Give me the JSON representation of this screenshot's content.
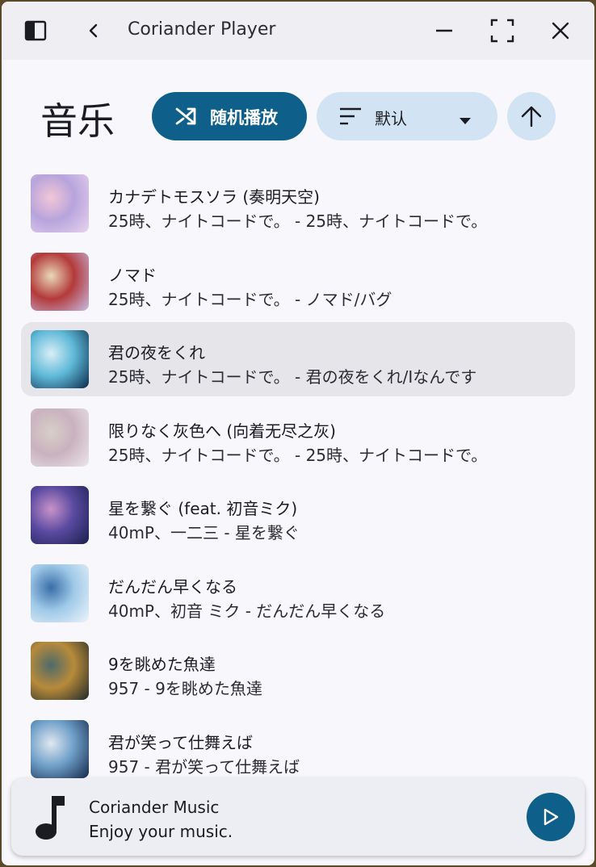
{
  "window": {
    "title": "Coriander Player"
  },
  "header": {
    "title": "音乐",
    "shuffle_label": "随机播放",
    "sort_label": "默认"
  },
  "tracks": [
    {
      "title": "カナデトモスソラ (奏明天空)",
      "subtitle": "25時、ナイトコードで。 - 25時、ナイトコードで。",
      "cover": [
        "#e9d3ee",
        "#b7a4dc",
        "#f3c6d6"
      ]
    },
    {
      "title": "ノマド",
      "subtitle": "25時、ナイトコードで。 - ノマド/バグ",
      "cover": [
        "#c7bde6",
        "#b33a3a",
        "#e8d9b8"
      ]
    },
    {
      "title": "君の夜をくれ",
      "subtitle": "25時、ナイトコードで。 - 君の夜をくれ/Iなんです",
      "cover": [
        "#0c2a4a",
        "#5fb9d8",
        "#d9eef5"
      ]
    },
    {
      "title": "限りなく灰色へ (向着无尽之灰)",
      "subtitle": "25時、ナイトコードで。 - 25時、ナイトコードで。",
      "cover": [
        "#ece6ea",
        "#c9b2bf",
        "#d8cfc8"
      ]
    },
    {
      "title": "星を繋ぐ (feat. 初音ミク)",
      "subtitle": "40mP、一二三 - 星を繋ぐ",
      "cover": [
        "#1a1f4e",
        "#5a4aa0",
        "#c893c9"
      ]
    },
    {
      "title": "だんだん早くなる",
      "subtitle": "40mP、初音 ミク - だんだん早くなる",
      "cover": [
        "#eef4fb",
        "#9fc9e8",
        "#3a6ea8"
      ]
    },
    {
      "title": "9を眺めた魚達",
      "subtitle": "957 - 9を眺めた魚達",
      "cover": [
        "#1e2a2a",
        "#b88a3a",
        "#4d6a6a"
      ]
    },
    {
      "title": "君が笑って仕舞えば",
      "subtitle": "957 - 君が笑って仕舞えば",
      "cover": [
        "#15284a",
        "#6f9fc8",
        "#e0e8f0"
      ]
    }
  ],
  "player": {
    "title": "Coriander Music",
    "subtitle": "Enjoy your music."
  },
  "icons": {
    "sidebar": "sidebar-toggle-icon",
    "back": "back-arrow-icon",
    "minimize": "minimize-icon",
    "maximize": "maximize-icon",
    "close": "close-icon",
    "shuffle": "shuffle-icon",
    "sort": "sort-lines-icon",
    "dropdown": "dropdown-caret-icon",
    "order": "arrow-up-icon",
    "note": "music-note-icon",
    "play": "play-icon"
  },
  "colors": {
    "accent": "#0e5f8a",
    "accent_light": "#d2e4f4",
    "selected_row": "#e6e6ea"
  }
}
